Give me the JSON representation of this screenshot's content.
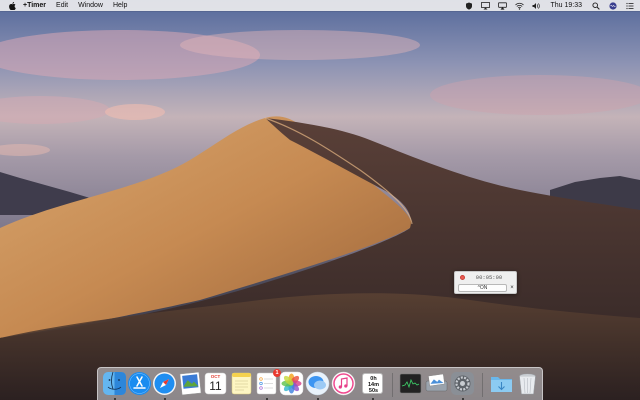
{
  "menubar": {
    "app_name": "+Timer",
    "menus": [
      "Edit",
      "Window",
      "Help"
    ],
    "clock": "Thu 19:33",
    "status_icons": [
      "shield-icon",
      "wifi-display-icon",
      "airplay-icon",
      "wifi-icon",
      "volume-icon",
      "search-icon",
      "siri-icon",
      "notification-center-icon"
    ]
  },
  "timer": {
    "time": "00:05:00",
    "start_label": "^ON",
    "close_label": "×",
    "record_color": "#ec5a52"
  },
  "dock": {
    "calendar": {
      "month": "OCT",
      "day": "11"
    },
    "reminders_badge": "1",
    "timer_lines": [
      "0h",
      "14m",
      "50s"
    ],
    "apps": [
      "finder",
      "app-store",
      "safari",
      "preview",
      "calendar",
      "notes",
      "reminders",
      "photos",
      "messages",
      "itunes",
      "timer",
      "activity-monitor",
      "image-capture",
      "system-preferences",
      "downloads",
      "trash"
    ]
  }
}
